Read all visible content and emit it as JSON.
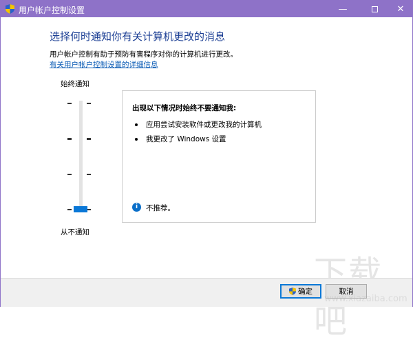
{
  "window": {
    "title": "用户帐户控制设置",
    "minimize_icon": "minimize-icon",
    "maximize_icon": "maximize-icon",
    "close_icon": "close-icon"
  },
  "main": {
    "heading": "选择何时通知你有关计算机更改的消息",
    "description": "用户帐户控制有助于预防有害程序对你的计算机进行更改。",
    "link": "有关用户帐户控制设置的详细信息"
  },
  "slider": {
    "top_label": "始终通知",
    "bottom_label": "从不通知",
    "levels": 4,
    "selected_level": 1
  },
  "info_box": {
    "heading": "出现以下情况时始终不要通知我:",
    "bullets": [
      "应用尝试安装软件或更改我的计算机",
      "我更改了 Windows 设置"
    ],
    "note": "不推荐。"
  },
  "footer": {
    "ok_label": "确定",
    "cancel_label": "取消"
  },
  "watermark": {
    "text": "下载吧",
    "url": "www.xiazaiba.com"
  },
  "colors": {
    "titlebar": "#8e72c8",
    "accent": "#0a78d7",
    "heading": "#1c3f94"
  }
}
